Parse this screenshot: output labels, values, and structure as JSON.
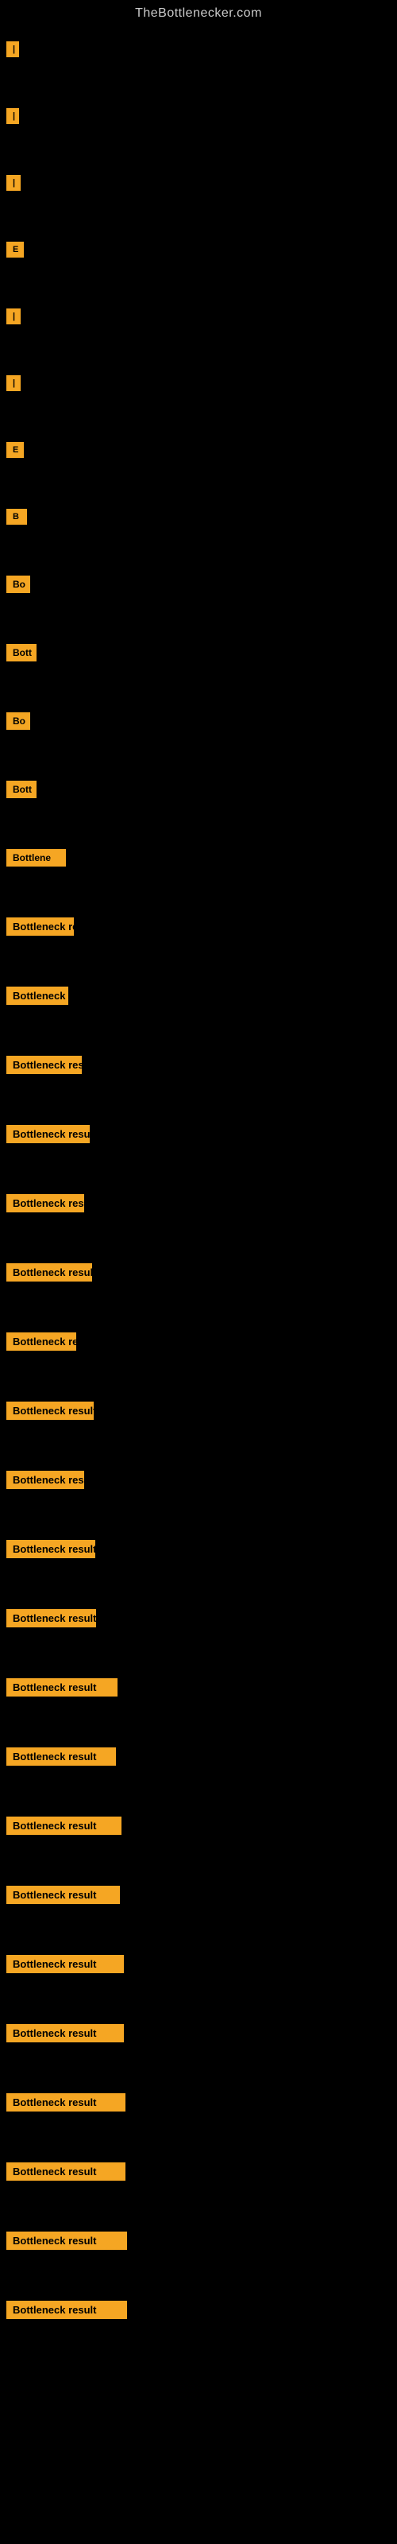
{
  "site": {
    "title": "TheBottlenecker.com"
  },
  "items": [
    {
      "id": 0,
      "label": "|"
    },
    {
      "id": 1,
      "label": "|"
    },
    {
      "id": 2,
      "label": "|"
    },
    {
      "id": 3,
      "label": "E"
    },
    {
      "id": 4,
      "label": "|"
    },
    {
      "id": 5,
      "label": "|"
    },
    {
      "id": 6,
      "label": "E"
    },
    {
      "id": 7,
      "label": "B"
    },
    {
      "id": 8,
      "label": "Bo"
    },
    {
      "id": 9,
      "label": "Bott"
    },
    {
      "id": 10,
      "label": "Bo"
    },
    {
      "id": 11,
      "label": "Bott"
    },
    {
      "id": 12,
      "label": "Bottlene"
    },
    {
      "id": 13,
      "label": "Bottleneck re"
    },
    {
      "id": 14,
      "label": "Bottleneck"
    },
    {
      "id": 15,
      "label": "Bottleneck res"
    },
    {
      "id": 16,
      "label": "Bottleneck result"
    },
    {
      "id": 17,
      "label": "Bottleneck res"
    },
    {
      "id": 18,
      "label": "Bottleneck resul"
    },
    {
      "id": 19,
      "label": "Bottleneck re"
    },
    {
      "id": 20,
      "label": "Bottleneck result"
    },
    {
      "id": 21,
      "label": "Bottleneck resu"
    },
    {
      "id": 22,
      "label": "Bottleneck result"
    },
    {
      "id": 23,
      "label": "Bottleneck result"
    },
    {
      "id": 24,
      "label": "Bottleneck result"
    },
    {
      "id": 25,
      "label": "Bottleneck result"
    },
    {
      "id": 26,
      "label": "Bottleneck result"
    },
    {
      "id": 27,
      "label": "Bottleneck result"
    },
    {
      "id": 28,
      "label": "Bottleneck result"
    },
    {
      "id": 29,
      "label": "Bottleneck result"
    },
    {
      "id": 30,
      "label": "Bottleneck result"
    },
    {
      "id": 31,
      "label": "Bottleneck result"
    },
    {
      "id": 32,
      "label": "Bottleneck result"
    },
    {
      "id": 33,
      "label": "Bottleneck result"
    }
  ]
}
